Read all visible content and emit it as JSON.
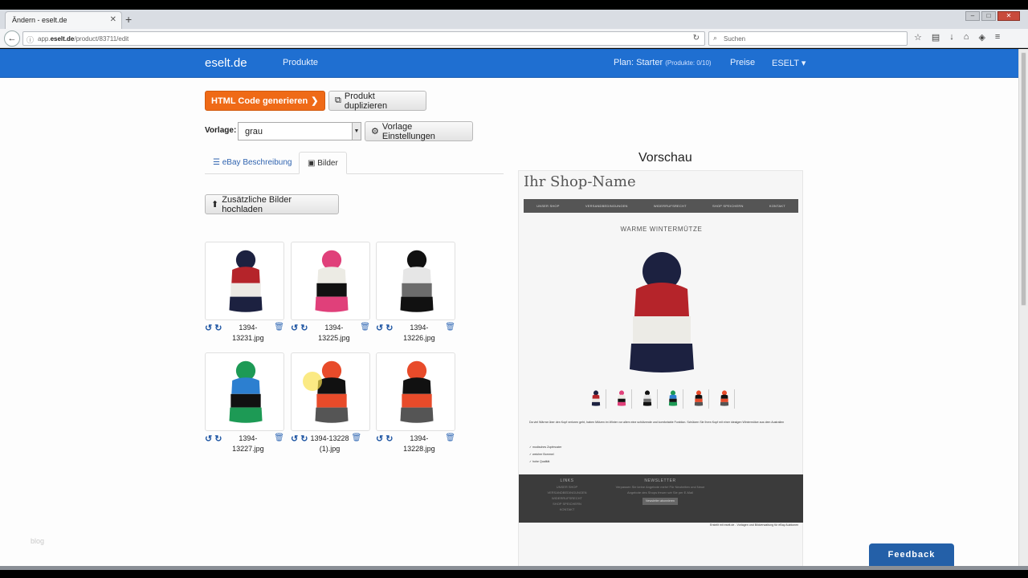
{
  "browser": {
    "tab_title": "Ändern - eselt.de",
    "url_prefix": "app.",
    "url_domain": "eselt.de",
    "url_path": "/product/83711/edit",
    "search_placeholder": "Suchen"
  },
  "app": {
    "brand": "eselt.de",
    "nav_products": "Produkte",
    "plan_label": "Plan: Starter",
    "plan_detail": "(Produkte: 0/10)",
    "prices": "Preise",
    "account": "ESELT ▾",
    "accent_color": "#1f6fd1"
  },
  "toolbar": {
    "generate_label": "HTML Code generieren",
    "duplicate_label": "Produkt duplizieren",
    "template_label": "Vorlage:",
    "template_value": "grau",
    "template_settings_label": "Vorlage Einstellungen",
    "tab_description": "eBay Beschreibung",
    "tab_images": "Bilder",
    "upload_label": "Zusätzliche Bilder hochladen"
  },
  "images": [
    {
      "filename": "1394-13231.jpg",
      "colors": [
        "#1c2140",
        "#b5242a",
        "#ece9e4",
        "#1c2140"
      ]
    },
    {
      "filename": "1394-13225.jpg",
      "colors": [
        "#e0407a",
        "#ecebe4",
        "#111111",
        "#e0407a"
      ]
    },
    {
      "filename": "1394-13226.jpg",
      "colors": [
        "#111111",
        "#e6e6e6",
        "#6c6c6c",
        "#111111"
      ]
    },
    {
      "filename": "1394-13227.jpg",
      "colors": [
        "#1d9a55",
        "#2c7fd0",
        "#111111",
        "#1d9a55"
      ]
    },
    {
      "filename": "1394-13228",
      "filename_line2": "(1).jpg",
      "colors": [
        "#e84b2a",
        "#111111",
        "#e84b2a",
        "#555555"
      ]
    },
    {
      "filename": "1394-13228.jpg",
      "colors": [
        "#e84b2a",
        "#111111",
        "#e84b2a",
        "#555555"
      ]
    }
  ],
  "preview": {
    "heading": "Vorschau",
    "shop_name": "Ihr Shop-Name",
    "nav": [
      "UNSER SHOP",
      "VERSANDBEDINGUNGEN",
      "WIDERRUFSRECHT",
      "SHOP SPEICHERN",
      "KONTAKT"
    ],
    "product_title": "WARME WINTERMÜTZE",
    "description": "Da viel Wärme über den Kopf verloren geht, haben Mützen im Winter vor allem eine schützende und komfortable Funktion. Schützen Sie Ihren Kopf mit einer idealgen Wintermütze aus dem Australien",
    "features": [
      "✓ modisches Zopfmuster",
      "✓ weicher Bommel",
      "✓ hohe Qualität"
    ],
    "footer_links_heading": "LINKS",
    "footer_links": [
      "UNSER SHOP",
      "VERSANDBEDINGUNGEN",
      "WIDERRUFSRECHT",
      "SHOP SPEICHERN",
      "KONTAKT"
    ],
    "footer_newsletter_heading": "NEWSLETTER",
    "footer_newsletter_text": "Verpassen Sie keine Angebote mehr! Für Neuheiten und Neue Angebote des Shops freuen wir Sie per E-Mail",
    "footer_newsletter_button": "Newsletter abonnieren",
    "credit": "Erstellt mit eselt.de - Vorlagen und Bildverwaltung für eBay Auktionen"
  },
  "feedback_label": "Feedback",
  "watermark": "blog"
}
